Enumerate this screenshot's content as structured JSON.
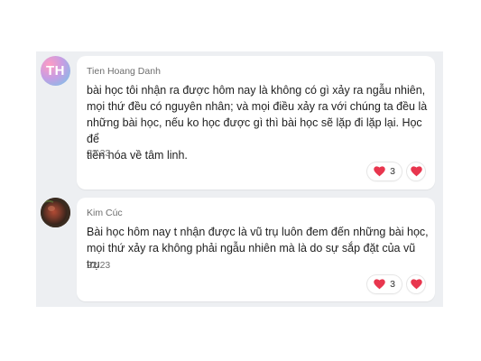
{
  "messages": [
    {
      "avatar": {
        "initials": "TH"
      },
      "sender": "Tien Hoang Danh",
      "text": "bài học tôi nhận ra được hôm nay là không có gì xảy ra ngẫu nhiên,\nmọi thứ đều có nguyên nhân; và mọi điều xảy ra với chúng ta đều là\nnhững bài học, nếu ko học được gì thì bài học sẽ lặp đi lặp lại. Học để\ntiến hóa về tâm linh.",
      "time": "22:23",
      "reaction": {
        "icon": "heart-icon",
        "count": "3"
      }
    },
    {
      "avatar": {
        "initials": ""
      },
      "sender": "Kim Cúc",
      "text": "Bài học hôm nay t nhận được là  vũ trụ luôn đem đến những bài học,\nmọi thứ xảy ra không phải ngẫu nhiên mà là do sự sắp đặt của vũ trụ",
      "time": "22:23",
      "reaction": {
        "icon": "heart-icon",
        "count": "3"
      }
    }
  ],
  "colors": {
    "heart": "#e8364e",
    "chat_background": "#edeff2"
  }
}
